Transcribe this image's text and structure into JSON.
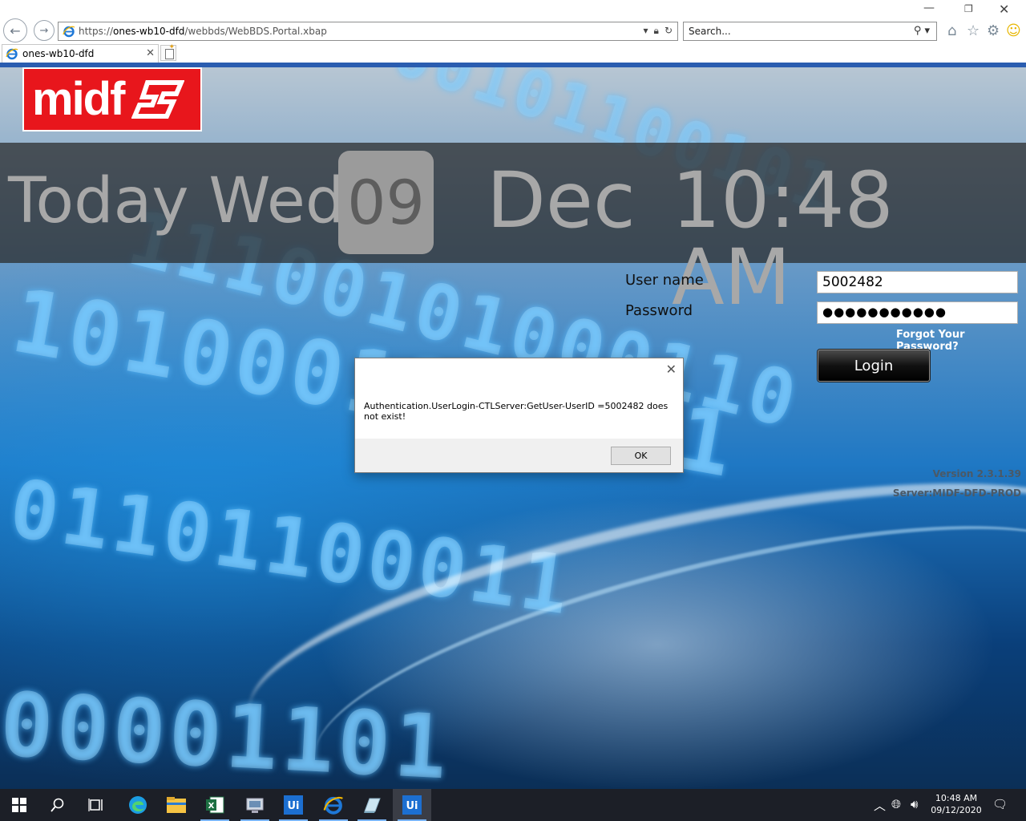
{
  "browser": {
    "address_url_prefix": "https://",
    "address_url_host": "ones-wb10-dfd",
    "address_url_path": "/webbds/WebBDS.Portal.xbap",
    "search_placeholder": "Search...",
    "tab_title": "ones-wb10-dfd"
  },
  "header": {
    "logo_text": "midf",
    "date_today": "Today Wed",
    "date_day": "09",
    "date_month": "Dec",
    "date_time": "10:48 AM"
  },
  "login": {
    "username_label": "User name",
    "password_label": "Password",
    "username_value": "5002482",
    "password_mask": "●●●●●●●●●●●",
    "forgot_link": "Forgot Your Password?",
    "login_button": "Login",
    "version": "Version 2.3.1.39",
    "server": "Server:MIDF-DFD-PROD"
  },
  "dialog": {
    "message": "Authentication.UserLogin-CTLServer:GetUser-UserID =5002482 does not exist!",
    "ok_label": "OK"
  },
  "taskbar": {
    "clock_time": "10:48 AM",
    "clock_date": "09/12/2020",
    "items": [
      "start-icon",
      "search-icon",
      "task-view-icon",
      "edge-icon",
      "file-explorer-icon",
      "excel-icon",
      "network-app-icon",
      "uipath-icon",
      "internet-explorer-icon",
      "notes-app-icon",
      "uipath-robot-icon"
    ]
  },
  "colors": {
    "brand_red": "#e8161c",
    "dialog_bg": "#ffffff",
    "taskbar_bg": "#1c1f27",
    "ie_blue": "#1e78d7"
  }
}
